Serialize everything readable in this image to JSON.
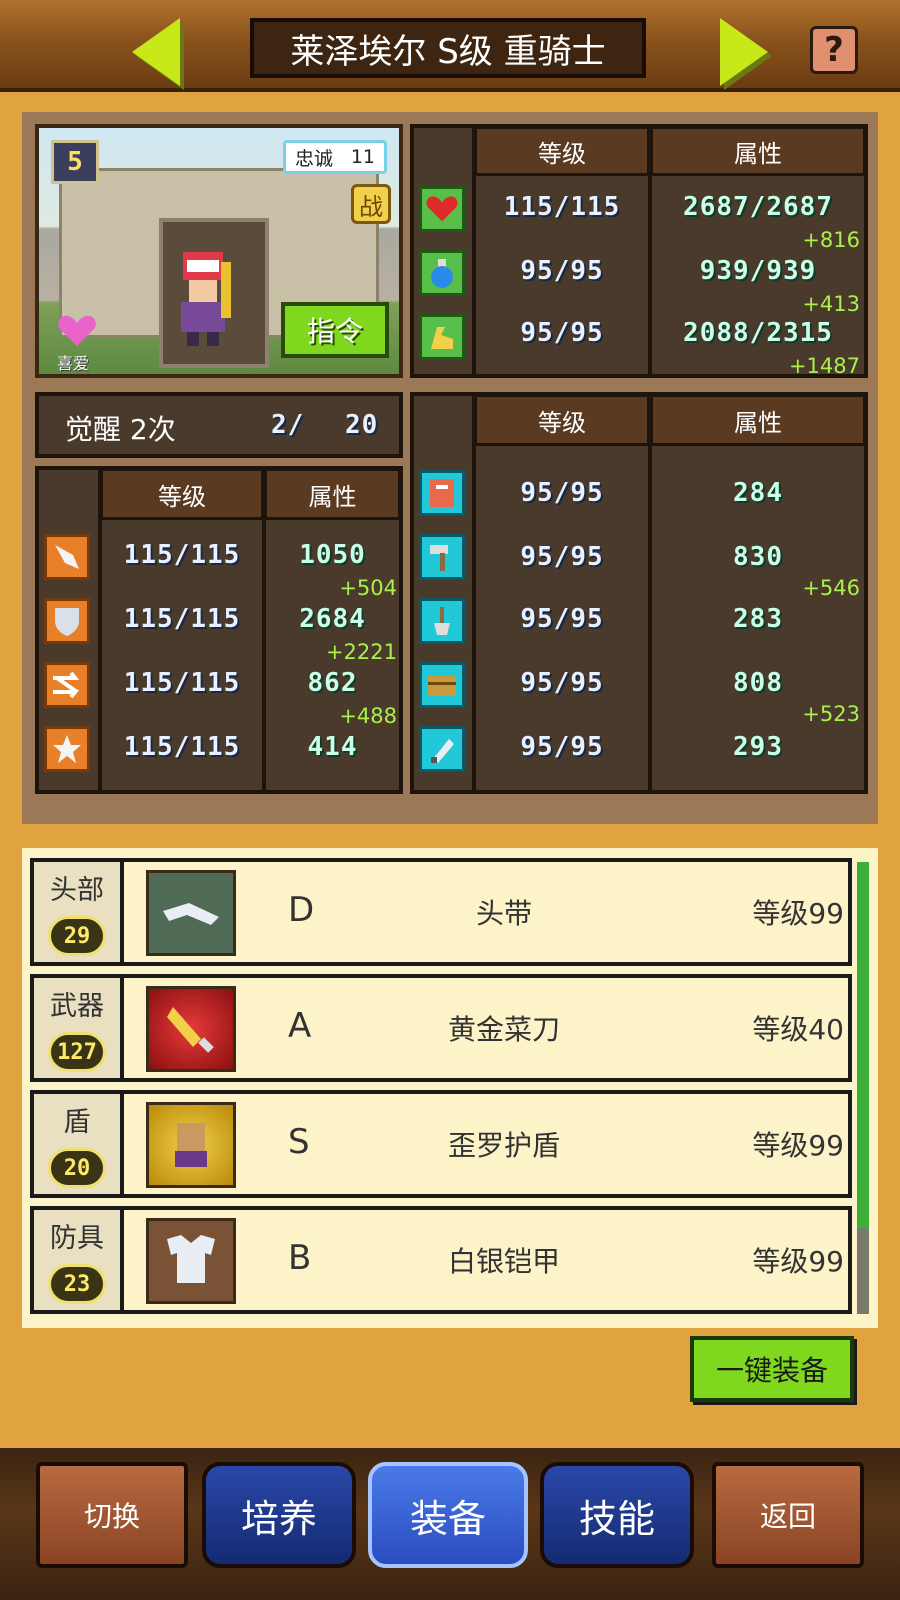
{
  "header": {
    "title": "莱泽埃尔 S级 重骑士",
    "help_glyph": "?"
  },
  "portrait": {
    "rank": "5",
    "loyalty_label": "忠诚",
    "loyalty_value": "11",
    "battle_badge": "战",
    "like_label": "喜爱",
    "command_button": "指令"
  },
  "main_stats": {
    "col_level": "等级",
    "col_attr": "属性",
    "rows": [
      {
        "icon": "heart-icon",
        "level": "115/115",
        "value": "2687/2687",
        "bonus": "+816"
      },
      {
        "icon": "potion-icon",
        "level": "95/95",
        "value": "939/939",
        "bonus": "+413"
      },
      {
        "icon": "muscle-icon",
        "level": "95/95",
        "value": "2088/2315",
        "bonus": "+1487"
      }
    ]
  },
  "awaken": {
    "label": "觉醒 2次",
    "count": "2/",
    "max": "20"
  },
  "combat_stats": {
    "col_level": "等级",
    "col_attr": "属性",
    "rows": [
      {
        "icon": "sword-icon",
        "level": "115/115",
        "value": "1050",
        "bonus": "+504"
      },
      {
        "icon": "shield-icon",
        "level": "115/115",
        "value": "2684",
        "bonus": "+2221"
      },
      {
        "icon": "speed-icon",
        "level": "115/115",
        "value": "862",
        "bonus": "+488"
      },
      {
        "icon": "star-icon",
        "level": "115/115",
        "value": "414",
        "bonus": ""
      }
    ]
  },
  "craft_stats": {
    "col_level": "等级",
    "col_attr": "属性",
    "rows": [
      {
        "icon": "book-icon",
        "level": "95/95",
        "value": "284",
        "bonus": ""
      },
      {
        "icon": "hammer-icon",
        "level": "95/95",
        "value": "830",
        "bonus": "+546"
      },
      {
        "icon": "shovel-icon",
        "level": "95/95",
        "value": "283",
        "bonus": ""
      },
      {
        "icon": "chest-icon",
        "level": "95/95",
        "value": "808",
        "bonus": "+523"
      },
      {
        "icon": "flask-icon",
        "level": "95/95",
        "value": "293",
        "bonus": ""
      }
    ]
  },
  "equipment": [
    {
      "slot": "头部",
      "slot_level": "29",
      "grade": "D",
      "name": "头带",
      "level": "等级99",
      "thumb_color": "#4f6b55"
    },
    {
      "slot": "武器",
      "slot_level": "127",
      "grade": "A",
      "name": "黄金菜刀",
      "level": "等级40",
      "thumb_color": "#b81c1c"
    },
    {
      "slot": "盾",
      "slot_level": "20",
      "grade": "S",
      "name": "歪罗护盾",
      "level": "等级99",
      "thumb_color": "#c9a40c"
    },
    {
      "slot": "防具",
      "slot_level": "23",
      "grade": "B",
      "name": "白银铠甲",
      "level": "等级99",
      "thumb_color": "#7a5236"
    }
  ],
  "equip_all_button": "一键装备",
  "nav": {
    "switch": "切换",
    "train": "培养",
    "equip": "装备",
    "skill": "技能",
    "back": "返回"
  },
  "colors": {
    "background": "#e1a33f",
    "accent_green": "#7fd81e",
    "bonus_green": "#a8f04a"
  }
}
